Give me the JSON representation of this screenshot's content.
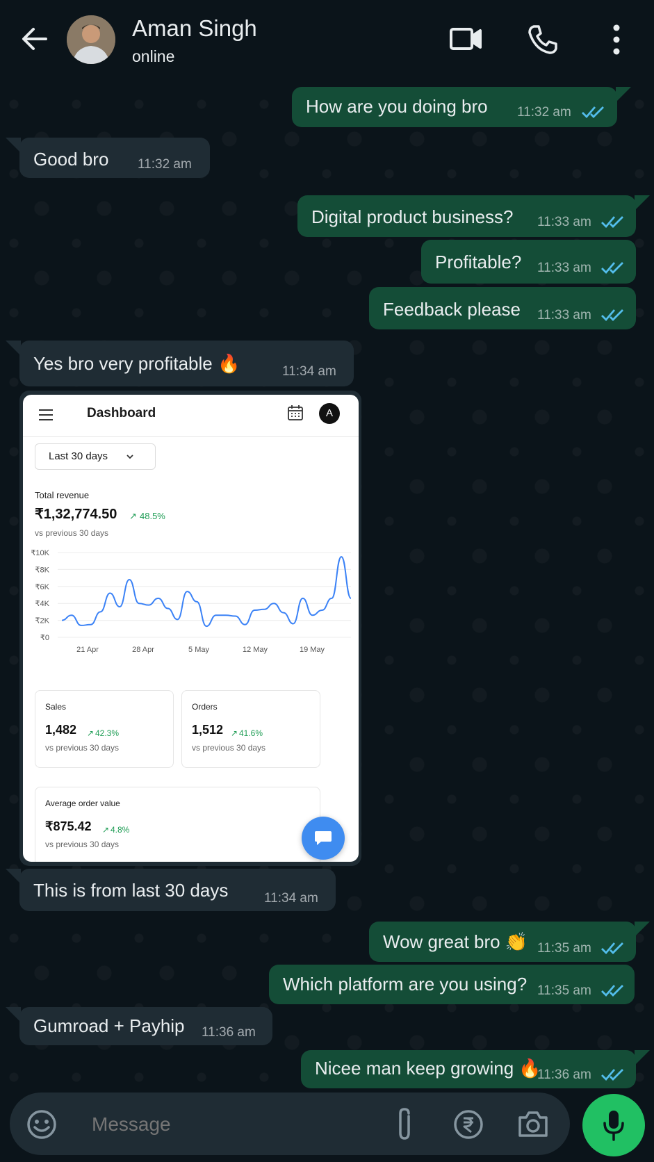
{
  "header": {
    "contact_name": "Aman Singh",
    "status": "online"
  },
  "colors": {
    "background": "#0b141a",
    "outgoing_bubble": "#144d37",
    "incoming_bubble": "#1f2c34",
    "read_ticks": "#53bdeb",
    "mic_button": "#21c063",
    "chart_line": "#3b82f6",
    "positive_change": "#1f9d55"
  },
  "messages": [
    {
      "dir": "out",
      "text": "How are you doing bro",
      "time": "11:32 am",
      "read": true
    },
    {
      "dir": "in",
      "text": "Good bro",
      "time": "11:32 am"
    },
    {
      "dir": "out",
      "text": "Digital product business?",
      "time": "11:33 am",
      "read": true
    },
    {
      "dir": "out",
      "text": "Profitable?",
      "time": "11:33 am",
      "read": true
    },
    {
      "dir": "out",
      "text": "Feedback please",
      "time": "11:33 am",
      "read": true
    },
    {
      "dir": "in",
      "text": "Yes bro very profitable 🔥",
      "time": "11:34 am"
    },
    {
      "dir": "in",
      "text": "This is from last 30 days",
      "time": "11:34 am"
    },
    {
      "dir": "out",
      "text": "Wow great bro 👏",
      "time": "11:35 am",
      "read": true
    },
    {
      "dir": "out",
      "text": "Which platform are you using?",
      "time": "11:35 am",
      "read": true
    },
    {
      "dir": "in",
      "text": "Gumroad + Payhip",
      "time": "11:36 am"
    },
    {
      "dir": "out",
      "text": "Nicee man keep growing 🔥",
      "time": "11:36 am",
      "read": true
    }
  ],
  "dashboard": {
    "title": "Dashboard",
    "avatar_letter": "A",
    "range": "Last 30 days",
    "total_revenue": {
      "label": "Total revenue",
      "value": "₹1,32,774.50",
      "change": "48.5%",
      "sub": "vs previous 30 days"
    },
    "sales": {
      "label": "Sales",
      "value": "1,482",
      "change": "42.3%",
      "sub": "vs previous 30 days"
    },
    "orders": {
      "label": "Orders",
      "value": "1,512",
      "change": "41.6%",
      "sub": "vs previous 30 days"
    },
    "aov": {
      "label": "Average order value",
      "value": "₹875.42",
      "change": "4.8%",
      "sub": "vs previous 30 days"
    }
  },
  "chart_data": {
    "type": "line",
    "y_ticks": [
      "₹10K",
      "₹8K",
      "₹6K",
      "₹4K",
      "₹2K",
      "₹0"
    ],
    "x_ticks": [
      "21 Apr",
      "28 Apr",
      "5 May",
      "12 May",
      "19 May"
    ],
    "ylim": [
      0,
      10000
    ],
    "values": [
      2000,
      2600,
      1400,
      1500,
      3000,
      5200,
      3600,
      6800,
      4000,
      3800,
      4600,
      3400,
      2100,
      5400,
      4200,
      1300,
      2600,
      2600,
      2500,
      1500,
      3200,
      3300,
      4000,
      2900,
      1600,
      4600,
      2600,
      3200,
      4600,
      9500,
      4600
    ]
  },
  "input": {
    "placeholder": "Message"
  }
}
